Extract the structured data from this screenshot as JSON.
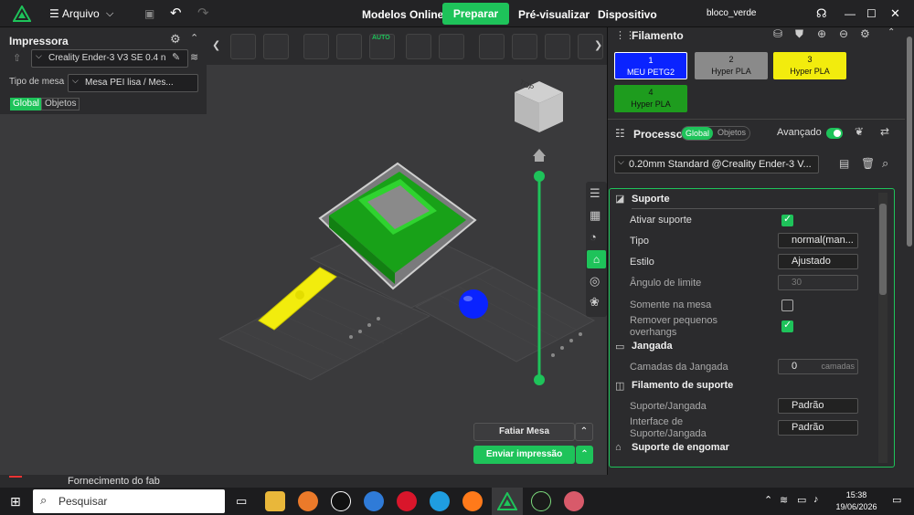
{
  "titlebar": {
    "menu_label": "Arquivo",
    "tabs": [
      "Modelos Online",
      "Preparar",
      "Pré-visualizar",
      "Dispositivo"
    ],
    "active_tab": "Preparar",
    "project_name": "bloco_verde",
    "accent": "#1ec35a"
  },
  "printer": {
    "title": "Impressora",
    "printer_name": "Creality Ender-3 V3 SE 0.4 n",
    "bed_label": "Tipo de mesa",
    "bed_value": "Mesa PEI lisa / Mes...",
    "scope_global": "Global",
    "scope_objects": "Objetos"
  },
  "toolbar": {
    "auto_label": "AUTO"
  },
  "viewport": {
    "slice_button": "Fatiar Mesa",
    "send_button": "Enviar impressão",
    "bottom_label": "Fornecimento do fab",
    "nav_cube_label": "TOP"
  },
  "filament": {
    "title": "Filamento",
    "cards": [
      {
        "num": "1",
        "name": "MEU PETG2",
        "color": "#0a23ff",
        "text_color": "#ffffff"
      },
      {
        "num": "2",
        "name": "Hyper PLA",
        "color": "#8a8a8a",
        "text_color": "#111111"
      },
      {
        "num": "3",
        "name": "Hyper PLA",
        "color": "#f2ec0d",
        "text_color": "#111111"
      },
      {
        "num": "4",
        "name": "Hyper PLA",
        "color": "#1e9c1e",
        "text_color": "#111111"
      }
    ]
  },
  "process": {
    "title": "Processo",
    "scope_global": "Global",
    "scope_objects": "Objetos",
    "advanced_label": "Avançado",
    "profile": "0.20mm Standard @Creality Ender-3 V..."
  },
  "settings": {
    "support_section": "Suporte",
    "enable_support": "Ativar suporte",
    "type_label": "Tipo",
    "type_value": "normal(man...",
    "style_label": "Estilo",
    "style_value": "Ajustado",
    "angle_label": "Ângulo de limite",
    "angle_value": "30",
    "only_bed": "Somente na mesa",
    "remove_small": "Remover pequenos overhangs",
    "raft_section": "Jangada",
    "raft_layers": "Camadas da Jangada",
    "raft_layers_value": "0",
    "raft_layers_unit": "camadas",
    "support_filament_section": "Filamento de suporte",
    "support_raft": "Suporte/Jangada",
    "support_raft_value": "Padrão",
    "support_interface": "Interface de Suporte/Jangada",
    "support_interface_value": "Padrão",
    "ironing_section": "Suporte de engomar"
  },
  "taskbar": {
    "search_placeholder": "Pesquisar",
    "time": "15:38",
    "date": "19/06/2026"
  }
}
